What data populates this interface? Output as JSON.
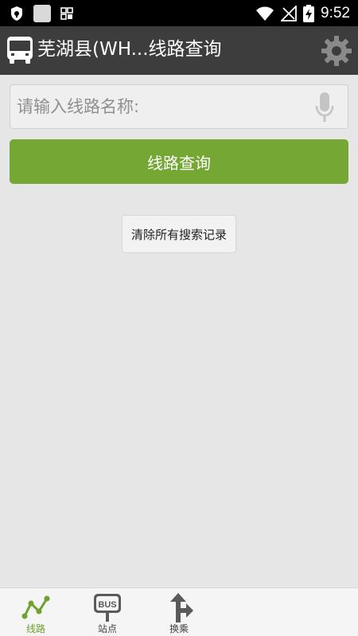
{
  "status_bar": {
    "time": "9:52"
  },
  "app_bar": {
    "title": "芜湖县(WH...线路查询"
  },
  "search": {
    "placeholder": "请输入线路名称:",
    "value": ""
  },
  "query_button": {
    "label": "线路查询"
  },
  "clear_history_button": {
    "label": "清除所有搜索记录"
  },
  "bottom_nav": {
    "items": [
      {
        "label": "线路",
        "icon": "route-line-icon",
        "active": true
      },
      {
        "label": "站点",
        "icon": "bus-stop-icon",
        "active": false
      },
      {
        "label": "换乘",
        "icon": "transfer-icon",
        "active": false
      }
    ]
  },
  "colors": {
    "accent_green": "#74a733",
    "app_bar": "#3d3d3d",
    "background": "#e6e6e6",
    "status_bar": "#000000"
  }
}
